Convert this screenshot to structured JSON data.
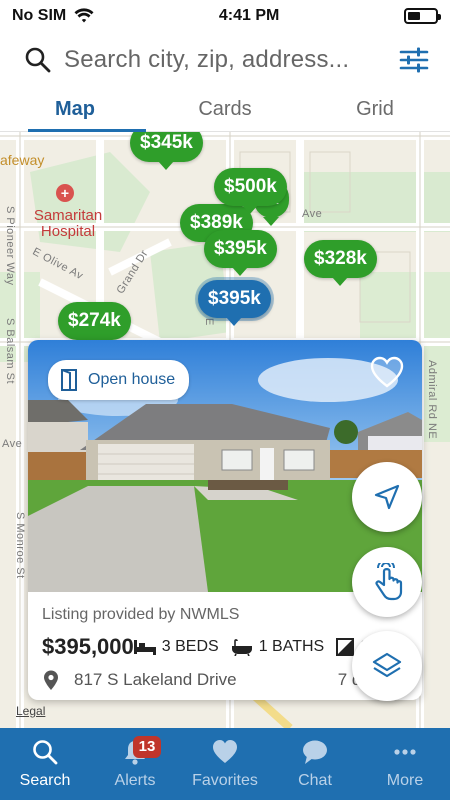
{
  "status_bar": {
    "carrier": "No SIM",
    "time": "4:41 PM"
  },
  "search": {
    "placeholder": "Search city, zip, address..."
  },
  "tabs": [
    {
      "label": "Map",
      "active": true
    },
    {
      "label": "Cards",
      "active": false
    },
    {
      "label": "Grid",
      "active": false
    }
  ],
  "map": {
    "labels": {
      "safeway": "afeway",
      "hospital": "Samaritan Hospital",
      "pioneer": "S Pioneer Way",
      "olive": "E Olive Av",
      "grand": "Grand Dr",
      "balsam": "S Balsam St",
      "ave_left": "Ave",
      "ave_top": "Ave",
      "ave_right": "Ave",
      "monroe": "S Monroe St",
      "admiral": "Admiral Rd NE",
      "e_label": "E"
    },
    "pins": [
      {
        "price": "$345k"
      },
      {
        "price": "$500k"
      },
      {
        "price": "k"
      },
      {
        "price": "$389k"
      },
      {
        "price": "$395k"
      },
      {
        "price": "$328k"
      },
      {
        "price": "$395k",
        "selected": true
      },
      {
        "price": "$274k"
      }
    ],
    "legal": "Legal"
  },
  "listing": {
    "badge": "Open house",
    "provider": "Listing provided by NWMLS",
    "price": "$395,000",
    "beds": "3 BEDS",
    "baths": "1 BATHS",
    "sqft_partial": "S",
    "address": "817 S Lakeland Drive",
    "days": "7 days o"
  },
  "nav": [
    {
      "label": "Search",
      "icon": "search-icon",
      "active": true
    },
    {
      "label": "Alerts",
      "icon": "bell-icon",
      "badge": "13"
    },
    {
      "label": "Favorites",
      "icon": "heart-icon"
    },
    {
      "label": "Chat",
      "icon": "chat-icon"
    },
    {
      "label": "More",
      "icon": "more-icon"
    }
  ],
  "colors": {
    "brand_blue": "#1f6fb0",
    "pin_green": "#2f9e2a",
    "badge_red": "#c0352b"
  }
}
